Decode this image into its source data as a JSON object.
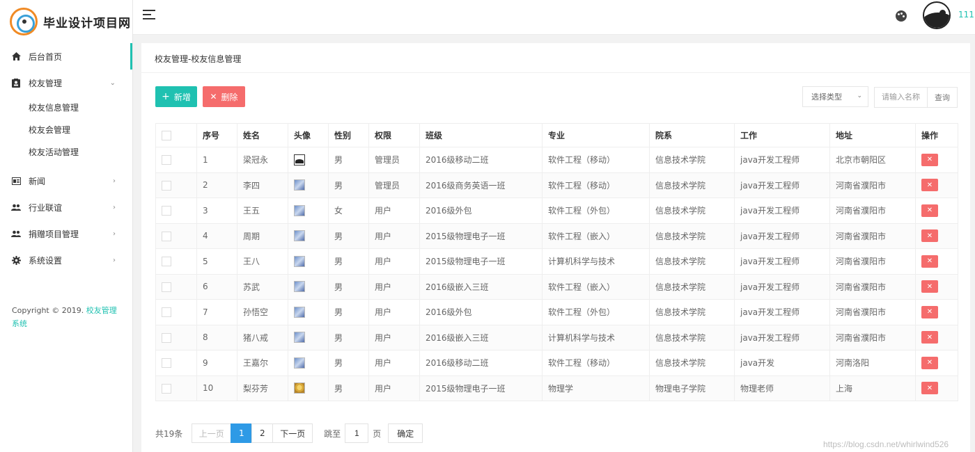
{
  "app": {
    "logo_text": "毕业设计项目网"
  },
  "sidebar": {
    "items": [
      {
        "label": "后台首页",
        "icon": "home-icon",
        "active": true
      },
      {
        "label": "校友管理",
        "icon": "contacts-icon",
        "arrow": "chevron-down-icon"
      },
      {
        "label": "新闻",
        "icon": "news-icon",
        "arrow": "chevron-right-icon"
      },
      {
        "label": "行业联谊",
        "icon": "group-icon",
        "arrow": "chevron-right-icon"
      },
      {
        "label": "捐赠项目管理",
        "icon": "group-icon",
        "arrow": "chevron-right-icon"
      },
      {
        "label": "系统设置",
        "icon": "gear-icon",
        "arrow": "chevron-right-icon"
      }
    ],
    "submenu": [
      "校友信息管理",
      "校友会管理",
      "校友活动管理"
    ],
    "copyright_prefix": "Copyright © 2019.",
    "copyright_link": "校友管理系统"
  },
  "header": {
    "username": "111"
  },
  "main": {
    "breadcrumb": "校友管理-校友信息管理",
    "add_label": "新增",
    "delete_label": "删除",
    "select_label": "选择类型",
    "search_placeholder": "请输入名称",
    "query_label": "查询"
  },
  "table": {
    "headers": [
      "序号",
      "姓名",
      "头像",
      "性别",
      "权限",
      "班级",
      "专业",
      "院系",
      "工作",
      "地址",
      "操作"
    ],
    "rows": [
      {
        "no": "1",
        "name": "梁冠永",
        "avatar": "black",
        "gender": "男",
        "role": "管理员",
        "class": "2016级移动二班",
        "major": "软件工程（移动）",
        "dept": "信息技术学院",
        "job": "java开发工程师",
        "addr": "北京市朝阳区"
      },
      {
        "no": "2",
        "name": "李四",
        "avatar": "blue",
        "gender": "男",
        "role": "管理员",
        "class": "2016级商务英语一班",
        "major": "软件工程（移动）",
        "dept": "信息技术学院",
        "job": "java开发工程师",
        "addr": "河南省濮阳市"
      },
      {
        "no": "3",
        "name": "王五",
        "avatar": "blue",
        "gender": "女",
        "role": "用户",
        "class": "2016级外包",
        "major": "软件工程（外包）",
        "dept": "信息技术学院",
        "job": "java开发工程师",
        "addr": "河南省濮阳市"
      },
      {
        "no": "4",
        "name": "周期",
        "avatar": "blue",
        "gender": "男",
        "role": "用户",
        "class": "2015级物理电子一班",
        "major": "软件工程（嵌入）",
        "dept": "信息技术学院",
        "job": "java开发工程师",
        "addr": "河南省濮阳市"
      },
      {
        "no": "5",
        "name": "王八",
        "avatar": "blue",
        "gender": "男",
        "role": "用户",
        "class": "2015级物理电子一班",
        "major": "计算机科学与技术",
        "dept": "信息技术学院",
        "job": "java开发工程师",
        "addr": "河南省濮阳市"
      },
      {
        "no": "6",
        "name": "苏武",
        "avatar": "blue",
        "gender": "男",
        "role": "用户",
        "class": "2016级嵌入三班",
        "major": "软件工程（嵌入）",
        "dept": "信息技术学院",
        "job": "java开发工程师",
        "addr": "河南省濮阳市"
      },
      {
        "no": "7",
        "name": "孙悟空",
        "avatar": "blue",
        "gender": "男",
        "role": "用户",
        "class": "2016级外包",
        "major": "软件工程（外包）",
        "dept": "信息技术学院",
        "job": "java开发工程师",
        "addr": "河南省濮阳市"
      },
      {
        "no": "8",
        "name": "猪八戒",
        "avatar": "blue",
        "gender": "男",
        "role": "用户",
        "class": "2016级嵌入三班",
        "major": "计算机科学与技术",
        "dept": "信息技术学院",
        "job": "java开发工程师",
        "addr": "河南省濮阳市"
      },
      {
        "no": "9",
        "name": "王嘉尔",
        "avatar": "blue",
        "gender": "男",
        "role": "用户",
        "class": "2016级移动二班",
        "major": "软件工程（移动）",
        "dept": "信息技术学院",
        "job": "java开发",
        "addr": "河南洛阳"
      },
      {
        "no": "10",
        "name": "梨芬芳",
        "avatar": "yellow",
        "gender": "男",
        "role": "用户",
        "class": "2015级物理电子一班",
        "major": "物理学",
        "dept": "物理电子学院",
        "job": "物理老师",
        "addr": "上海"
      }
    ]
  },
  "pagination": {
    "total": "共19条",
    "prev": "上一页",
    "pages": [
      "1",
      "2"
    ],
    "current": "1",
    "next": "下一页",
    "jump_label": "跳至",
    "jump_value": "1",
    "page_unit": "页",
    "confirm": "确定"
  },
  "watermark": "https://blog.csdn.net/whirlwind526"
}
